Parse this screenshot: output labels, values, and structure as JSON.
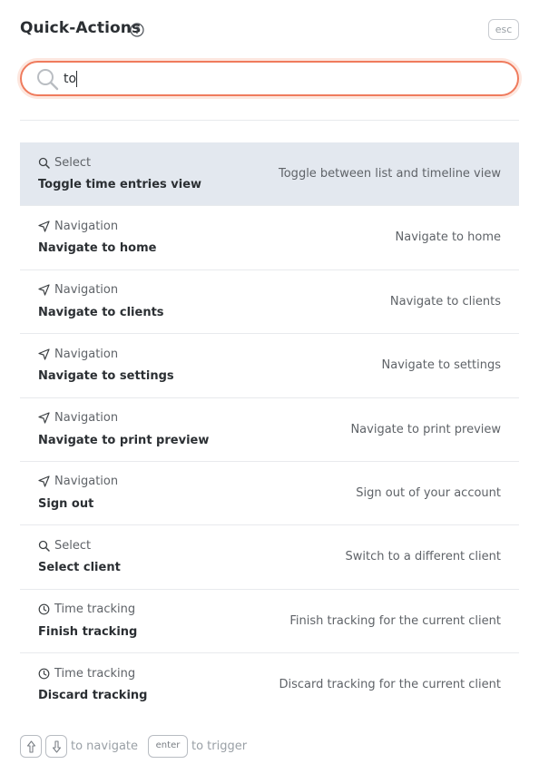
{
  "header": {
    "title": "Quick-Actions",
    "esc_label": "esc"
  },
  "search": {
    "value": "to",
    "placeholder": ""
  },
  "actions": [
    {
      "category": "Select",
      "category_icon": "search-icon",
      "name": "Toggle time entries view",
      "description": "Toggle between list and timeline view",
      "selected": true
    },
    {
      "category": "Navigation",
      "category_icon": "navigation-arrow-icon",
      "name": "Navigate to home",
      "description": "Navigate to home",
      "selected": false
    },
    {
      "category": "Navigation",
      "category_icon": "navigation-arrow-icon",
      "name": "Navigate to clients",
      "description": "Navigate to clients",
      "selected": false
    },
    {
      "category": "Navigation",
      "category_icon": "navigation-arrow-icon",
      "name": "Navigate to settings",
      "description": "Navigate to settings",
      "selected": false
    },
    {
      "category": "Navigation",
      "category_icon": "navigation-arrow-icon",
      "name": "Navigate to print preview",
      "description": "Navigate to print preview",
      "selected": false
    },
    {
      "category": "Navigation",
      "category_icon": "navigation-arrow-icon",
      "name": "Sign out",
      "description": "Sign out of your account",
      "selected": false
    },
    {
      "category": "Select",
      "category_icon": "search-icon",
      "name": "Select client",
      "description": "Switch to a different client",
      "selected": false
    },
    {
      "category": "Time tracking",
      "category_icon": "clock-icon",
      "name": "Finish tracking",
      "description": "Finish tracking for the current client",
      "selected": false
    },
    {
      "category": "Time tracking",
      "category_icon": "clock-icon",
      "name": "Discard tracking",
      "description": "Discard tracking for the current client",
      "selected": false
    }
  ],
  "footer": {
    "navigate_text": "to navigate",
    "enter_label": "enter",
    "trigger_text": "to trigger"
  },
  "colors": {
    "accent": "#ef7b5d",
    "selected_bg": "#e3e8ef"
  }
}
